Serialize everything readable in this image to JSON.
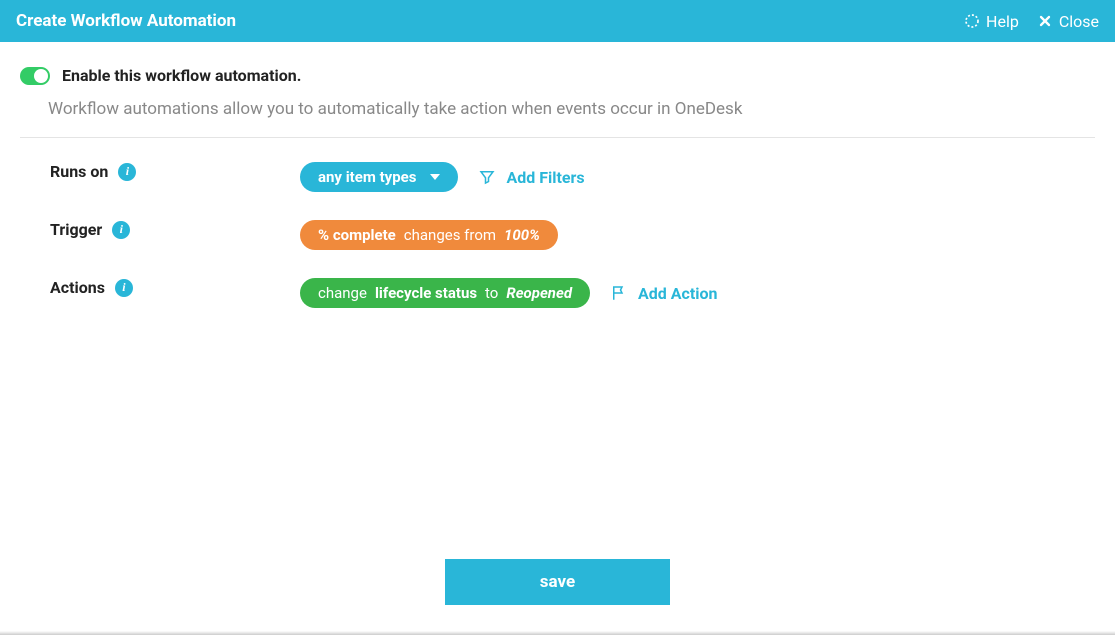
{
  "header": {
    "title": "Create Workflow Automation",
    "help": "Help",
    "close": "Close"
  },
  "enable": {
    "label": "Enable this workflow automation.",
    "on": true
  },
  "description": "Workflow automations allow you to automatically take action when events occur in OneDesk",
  "rows": {
    "runs_on": {
      "label": "Runs on",
      "pill": "any item types",
      "add_filters": "Add Filters"
    },
    "trigger": {
      "label": "Trigger",
      "field": "% complete",
      "verb": "changes from",
      "value": "100%"
    },
    "actions": {
      "label": "Actions",
      "verb": "change",
      "field": "lifecycle status",
      "to": "to",
      "value": "Reopened",
      "add_action": "Add Action"
    }
  },
  "save": "save"
}
